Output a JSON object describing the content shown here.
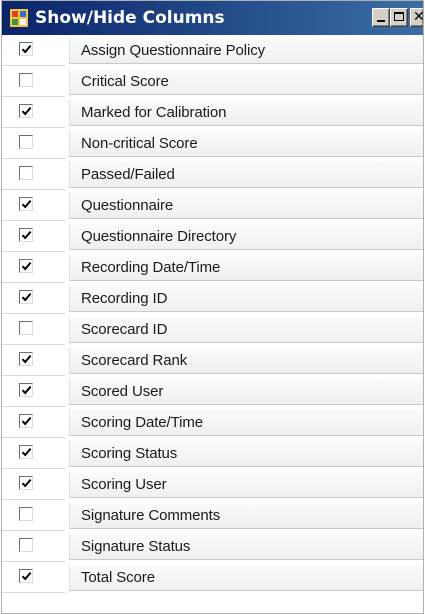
{
  "window": {
    "title": "Show/Hide Columns",
    "minimize_glyph": "",
    "maximize_glyph": "",
    "close_glyph": "✕"
  },
  "columns": [
    {
      "label": "Assign Questionnaire Policy",
      "checked": true
    },
    {
      "label": "Critical Score",
      "checked": false
    },
    {
      "label": "Marked for Calibration",
      "checked": true
    },
    {
      "label": "Non-critical Score",
      "checked": false
    },
    {
      "label": "Passed/Failed",
      "checked": false
    },
    {
      "label": "Questionnaire",
      "checked": true
    },
    {
      "label": "Questionnaire Directory",
      "checked": true
    },
    {
      "label": "Recording Date/Time",
      "checked": true
    },
    {
      "label": "Recording ID",
      "checked": true
    },
    {
      "label": "Scorecard ID",
      "checked": false
    },
    {
      "label": "Scorecard Rank",
      "checked": true
    },
    {
      "label": "Scored User",
      "checked": true
    },
    {
      "label": "Scoring Date/Time",
      "checked": true
    },
    {
      "label": "Scoring Status",
      "checked": true
    },
    {
      "label": "Scoring User",
      "checked": true
    },
    {
      "label": "Signature Comments",
      "checked": false
    },
    {
      "label": "Signature Status",
      "checked": false
    },
    {
      "label": "Total Score",
      "checked": true
    }
  ],
  "colors": {
    "titlebar_start": "#0a246a",
    "titlebar_end": "#3a6ea5",
    "title_text": "#ffffff",
    "row_label_bg": "#f3f3f3"
  }
}
